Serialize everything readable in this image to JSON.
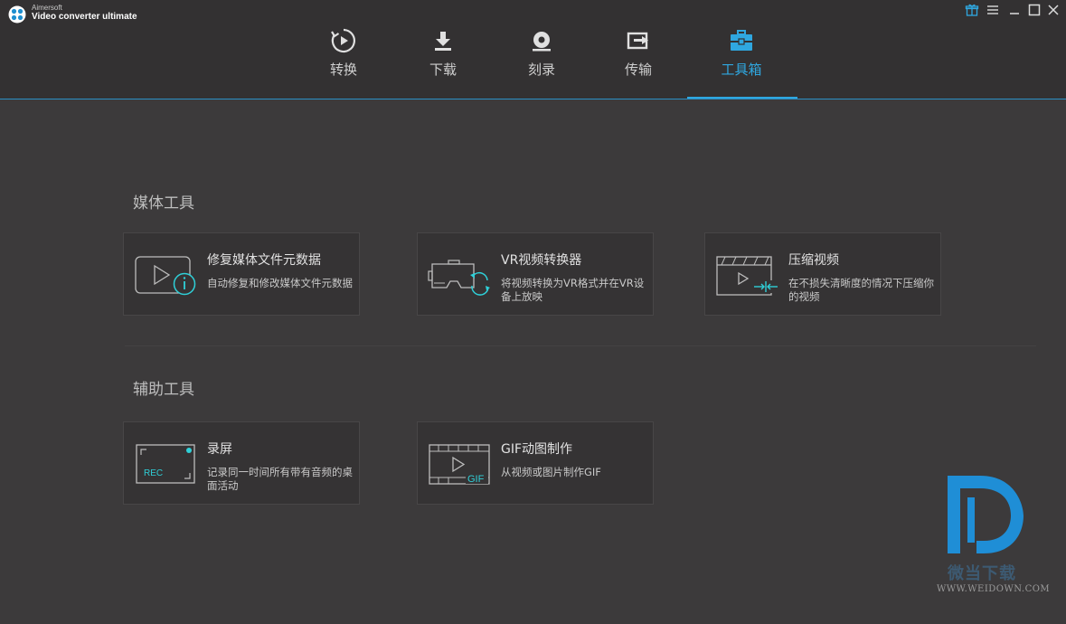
{
  "app": {
    "vendor": "Aimersoft",
    "name": "Video converter ultimate",
    "accent_color": "#2fa7e0"
  },
  "window_controls": [
    "gift-icon",
    "menu-icon",
    "minimize-icon",
    "maximize-icon",
    "close-icon"
  ],
  "tabs": [
    {
      "label": "转换",
      "icon": "convert-icon"
    },
    {
      "label": "下载",
      "icon": "download-icon"
    },
    {
      "label": "刻录",
      "icon": "burn-disc-icon"
    },
    {
      "label": "传输",
      "icon": "transfer-icon"
    },
    {
      "label": "工具箱",
      "icon": "toolbox-icon",
      "active": true
    }
  ],
  "sections": [
    {
      "title": "媒体工具",
      "cards": [
        {
          "title": "修复媒体文件元数据",
          "desc": "自动修复和修改媒体文件元数据",
          "icon": "metadata-icon"
        },
        {
          "title": "VR视频转换器",
          "desc": "将视频转换为VR格式并在VR设备上放映",
          "icon": "vr-headset-icon"
        },
        {
          "title": "压缩视频",
          "desc": "在不损失清晰度的情况下压缩你的视频",
          "icon": "compress-video-icon"
        }
      ]
    },
    {
      "title": "辅助工具",
      "cards": [
        {
          "title": "录屏",
          "desc": "记录同一时间所有带有音频的桌面活动",
          "icon": "screen-record-icon",
          "icon_text": "REC"
        },
        {
          "title": "GIF动图制作",
          "desc": "从视频或图片制作GIF",
          "icon": "gif-maker-icon",
          "icon_text": "GIF"
        }
      ]
    }
  ],
  "watermark": {
    "text": "微当下载",
    "url": "WWW.WEIDOWN.COM"
  }
}
